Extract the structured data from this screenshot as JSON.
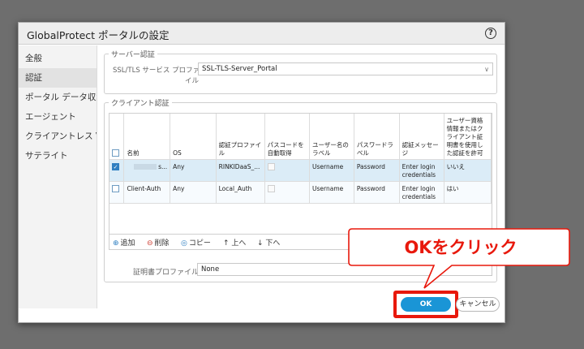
{
  "dialog": {
    "title": "GlobalProtect ポータルの設定",
    "help_icon": "?"
  },
  "sidebar": {
    "items": [
      {
        "label": "全般"
      },
      {
        "label": "認証"
      },
      {
        "label": "ポータル データ収集"
      },
      {
        "label": "エージェント"
      },
      {
        "label": "クライアントレス VPN"
      },
      {
        "label": "サテライト"
      }
    ]
  },
  "server_auth": {
    "legend": "サーバー認証",
    "profile_label_1": "SSL/TLS サービス プロファ",
    "profile_label_2": "イル",
    "profile_value": "SSL-TLS-Server_Portal"
  },
  "client_auth": {
    "legend": "クライアント認証",
    "columns": [
      "名前",
      "OS",
      "認証プロファイル",
      "パスコードを自動取得",
      "ユーザー名のラベル",
      "パスワードラベル",
      "認証メッセージ",
      "ユーザー資格情報またはクライアント証明書を使用した認証を許可"
    ],
    "rows": [
      {
        "selected": true,
        "name": "s...",
        "os": "Any",
        "auth_profile": "RINKIDaaS_...",
        "username_label": "Username",
        "password_label": "Password",
        "auth_message": "Enter login credentials",
        "allow": "いいえ"
      },
      {
        "selected": false,
        "name": "Client-Auth",
        "os": "Any",
        "auth_profile": "Local_Auth",
        "username_label": "Username",
        "password_label": "Password",
        "auth_message": "Enter login credentials",
        "allow": "はい"
      }
    ],
    "toolbar": {
      "add": "追加",
      "delete": "削除",
      "copy": "コピー",
      "up": "上へ",
      "down": "下へ"
    },
    "cert_profile_label": "証明書プロファイル",
    "cert_profile_value": "None"
  },
  "buttons": {
    "ok": "OK",
    "cancel": "キャンセル"
  },
  "annotation": {
    "callout_text": "OKをクリック",
    "accent_color": "#e8180c"
  }
}
